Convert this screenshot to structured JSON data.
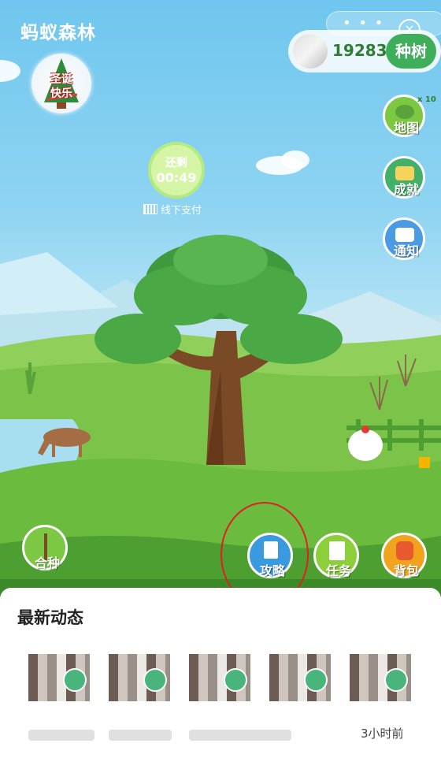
{
  "header": {
    "title": "蚂蚁森林",
    "energy": "19283g",
    "plant_button": "种树"
  },
  "banner": {
    "xmas_text_line1": "圣诞",
    "xmas_text_line2": "快乐"
  },
  "timer": {
    "label": "还剩",
    "value": "00:49",
    "offline": "线下支付"
  },
  "side_menu": [
    {
      "label": "地图",
      "badge": "x 10"
    },
    {
      "label": "成就"
    },
    {
      "label": "通知"
    }
  ],
  "bottom_menu": {
    "cooperate": "合种",
    "strategy": "攻略",
    "tasks": "任务",
    "backpack": "背包"
  },
  "feed": {
    "title": "最新动态",
    "time": "3小时前"
  },
  "colors": {
    "accent": "#3fae5a",
    "annotation": "#e02020"
  }
}
